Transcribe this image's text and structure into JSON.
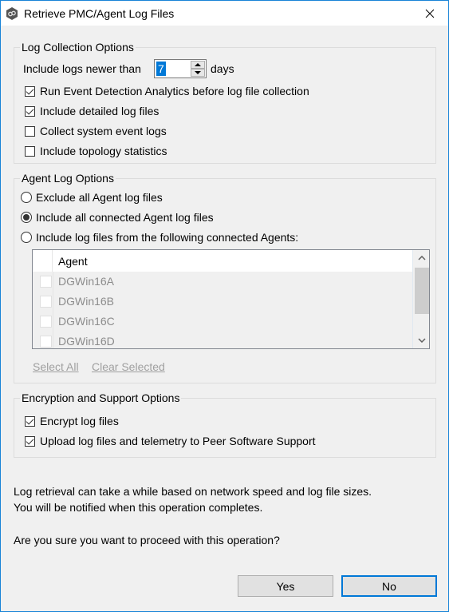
{
  "window": {
    "title": "Retrieve PMC/Agent Log Files",
    "app_icon": "peer-software-gear-icon",
    "close_icon": "close-icon"
  },
  "log_collection": {
    "label": "Log Collection Options",
    "newer_than_prefix": "Include logs newer than",
    "newer_than_value": "7",
    "newer_than_suffix": "days",
    "options": [
      {
        "label": "Run Event Detection Analytics before log file collection",
        "checked": true
      },
      {
        "label": "Include detailed log files",
        "checked": true
      },
      {
        "label": "Collect system event logs",
        "checked": false
      },
      {
        "label": "Include topology statistics",
        "checked": false
      }
    ]
  },
  "agent_log": {
    "label": "Agent Log Options",
    "radios": [
      {
        "label": "Exclude all Agent log files",
        "selected": false
      },
      {
        "label": "Include all connected Agent log files",
        "selected": true
      },
      {
        "label": "Include log files from the following connected Agents:",
        "selected": false
      }
    ],
    "grid": {
      "column_header": "Agent",
      "rows": [
        {
          "name": "DGWin16A",
          "checked": false
        },
        {
          "name": "DGWin16B",
          "checked": false
        },
        {
          "name": "DGWin16C",
          "checked": false
        },
        {
          "name": "DGWin16D",
          "checked": false
        }
      ],
      "enabled": false
    },
    "select_all": "Select All",
    "clear_selected": "Clear Selected"
  },
  "encryption": {
    "label": "Encryption and Support Options",
    "options": [
      {
        "label": "Encrypt log files",
        "checked": true
      },
      {
        "label": "Upload log files and telemetry to Peer Software Support",
        "checked": true
      }
    ]
  },
  "message": {
    "line1": "Log retrieval can take a while based on network speed and log file sizes.",
    "line2": "You will be notified when this operation completes.",
    "question": "Are you sure you want to proceed with this operation?"
  },
  "buttons": {
    "yes": "Yes",
    "no": "No",
    "default": "no"
  },
  "colors": {
    "accent": "#0078d7",
    "window_border": "#1883d7",
    "background": "#f0f0f0",
    "disabled_text": "#a0a0a0"
  }
}
